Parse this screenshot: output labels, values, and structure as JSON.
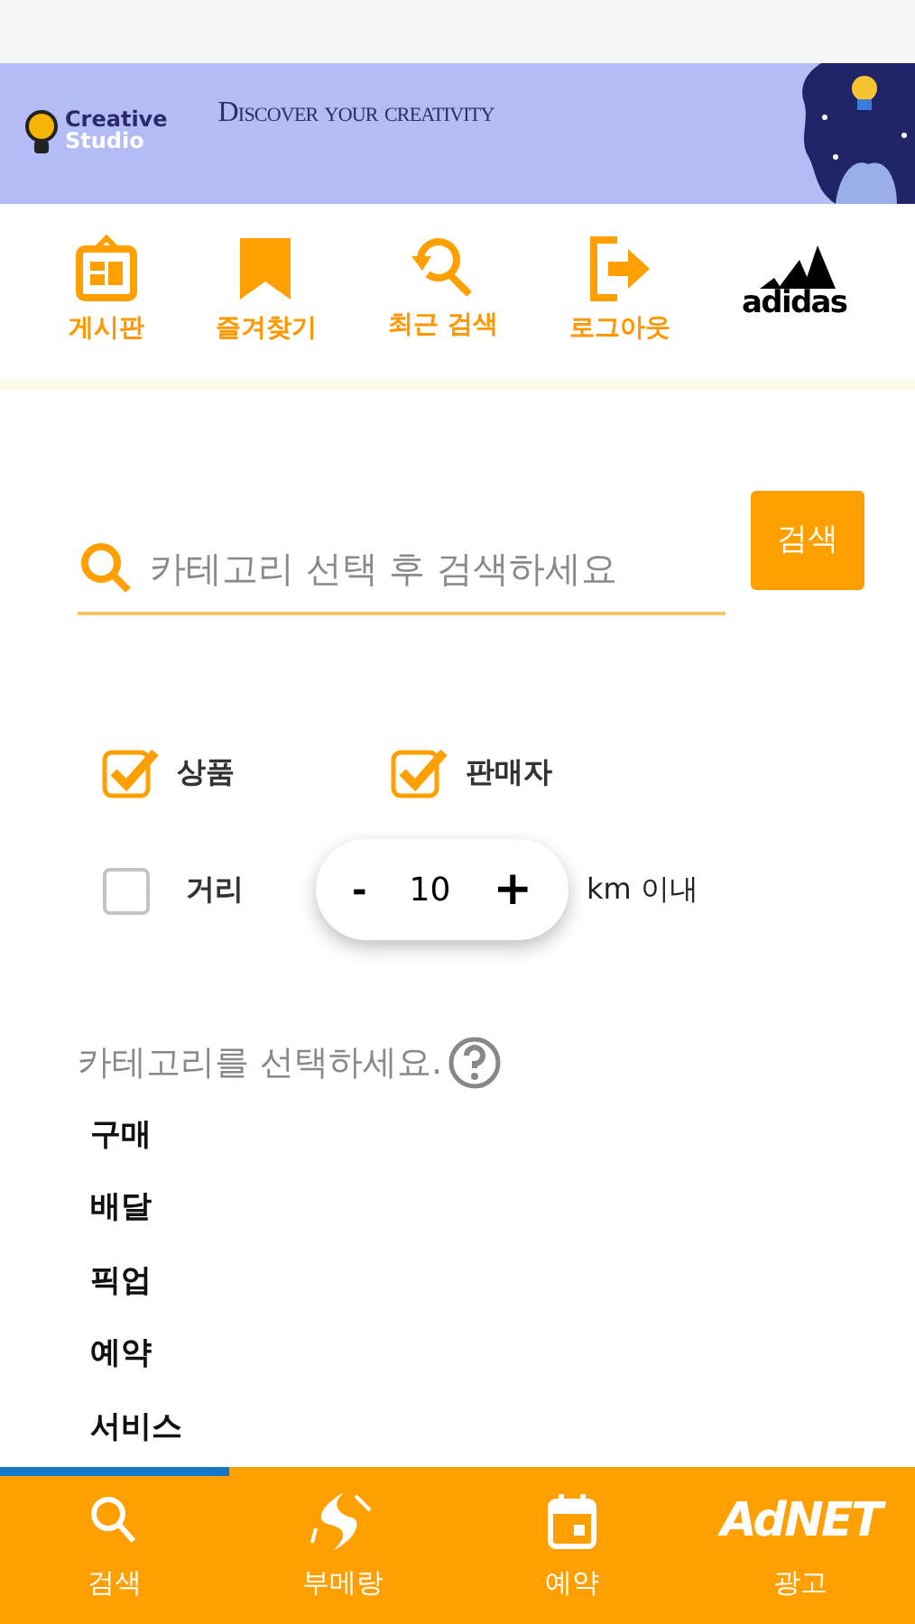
{
  "banner": {
    "logo_title": "Creative",
    "logo_subtitle": "Studio",
    "tagline": "Discover your creativity",
    "kind": "picture"
  },
  "quick_menu": [
    {
      "label": "게시판",
      "kind": "board"
    },
    {
      "label": "즐겨찾기",
      "kind": "bookmark"
    },
    {
      "label": "최근 검색",
      "kind": "history"
    },
    {
      "label": "로그아웃",
      "kind": "logout"
    },
    {
      "label": "adidas",
      "kind": "brand"
    }
  ],
  "search": {
    "placeholder": "카테고리 선택 후 검색하세요",
    "button": "검색"
  },
  "filters": [
    {
      "label": "상품",
      "checked": true
    },
    {
      "label": "판매자",
      "checked": true
    }
  ],
  "distance": {
    "label": "거리",
    "checked": false,
    "minus": "-",
    "value": "10",
    "plus": "+",
    "unit": "km 이내"
  },
  "category": {
    "heading": "카테고리를 선택하세요.",
    "items": [
      "구매",
      "배달",
      "픽업",
      "예약",
      "서비스"
    ]
  },
  "progress": {
    "level": 0.25
  },
  "bottom_nav": [
    {
      "label": "검색",
      "kind": "search"
    },
    {
      "label": "부메랑",
      "kind": "boomerang"
    },
    {
      "label": "예약",
      "kind": "calendar"
    },
    {
      "label": "광고",
      "kind": "adnet",
      "logo": "AdNET"
    }
  ]
}
